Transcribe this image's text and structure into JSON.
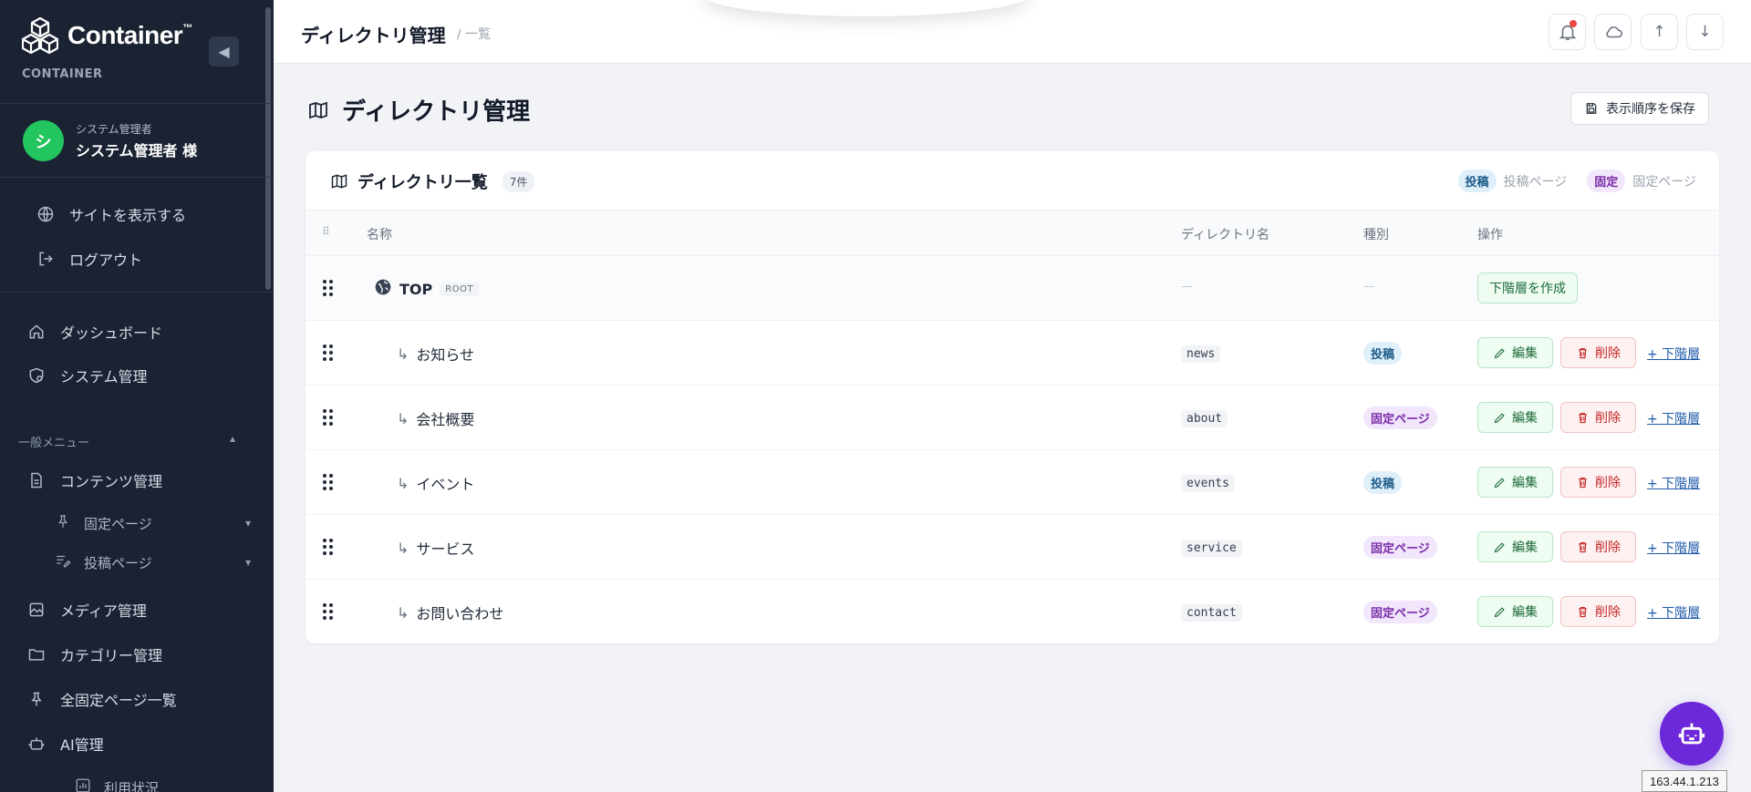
{
  "sidebar": {
    "brand": "Container",
    "brand_tm": "™",
    "brand_sub": "CONTAINER",
    "collapse_icon": "◀",
    "user": {
      "avatar_initial": "シ",
      "role": "システム管理者",
      "name": "システム管理者 様"
    },
    "site_link": "サイトを表示する",
    "logout": "ログアウト",
    "dashboard": "ダッシュボード",
    "system": "システム管理",
    "section_label": "一般メニュー",
    "contents": "コンテンツ管理",
    "fixed_pages": "固定ページ",
    "post_pages": "投稿ページ",
    "media": "メディア管理",
    "category": "カテゴリー管理",
    "all_fixed": "全固定ページ一覧",
    "ai": "AI管理",
    "usage": "利用状況"
  },
  "topbar": {
    "title": "ディレクトリ管理",
    "crumb": "/ 一覧",
    "up_icon": "↑",
    "down_icon": "↓"
  },
  "page": {
    "heading": "ディレクトリ管理",
    "save_order": "表示順序を保存"
  },
  "card": {
    "title": "ディレクトリ一覧",
    "count": "7件",
    "legend": {
      "post_pill": "投稿",
      "post_text": "投稿ページ",
      "fixed_pill": "固定",
      "fixed_text": "固定ページ"
    },
    "columns": {
      "name": "名称",
      "dir": "ディレクトリ名",
      "type": "種別",
      "ops": "操作"
    },
    "root": {
      "name": "TOP",
      "tag": "ROOT",
      "dir": "—",
      "type": "—",
      "create_label": "下階層を作成"
    },
    "rows": [
      {
        "name": "お知らせ",
        "dir": "news",
        "type": "投稿",
        "type_kind": "post"
      },
      {
        "name": "会社概要",
        "dir": "about",
        "type": "固定ページ",
        "type_kind": "fixed"
      },
      {
        "name": "イベント",
        "dir": "events",
        "type": "投稿",
        "type_kind": "post"
      },
      {
        "name": "サービス",
        "dir": "service",
        "type": "固定ページ",
        "type_kind": "fixed"
      },
      {
        "name": "お問い合わせ",
        "dir": "contact",
        "type": "固定ページ",
        "type_kind": "fixed"
      }
    ],
    "actions": {
      "edit": "編集",
      "delete": "削除",
      "sub": "+ 下階層"
    },
    "child_arrow": "↳"
  },
  "ip_address": "163.44.1.213",
  "colors": {
    "sidebar_bg": "#1b2333",
    "accent": "#6d28d9",
    "success": "#1e6b3a",
    "danger": "#c62828"
  }
}
